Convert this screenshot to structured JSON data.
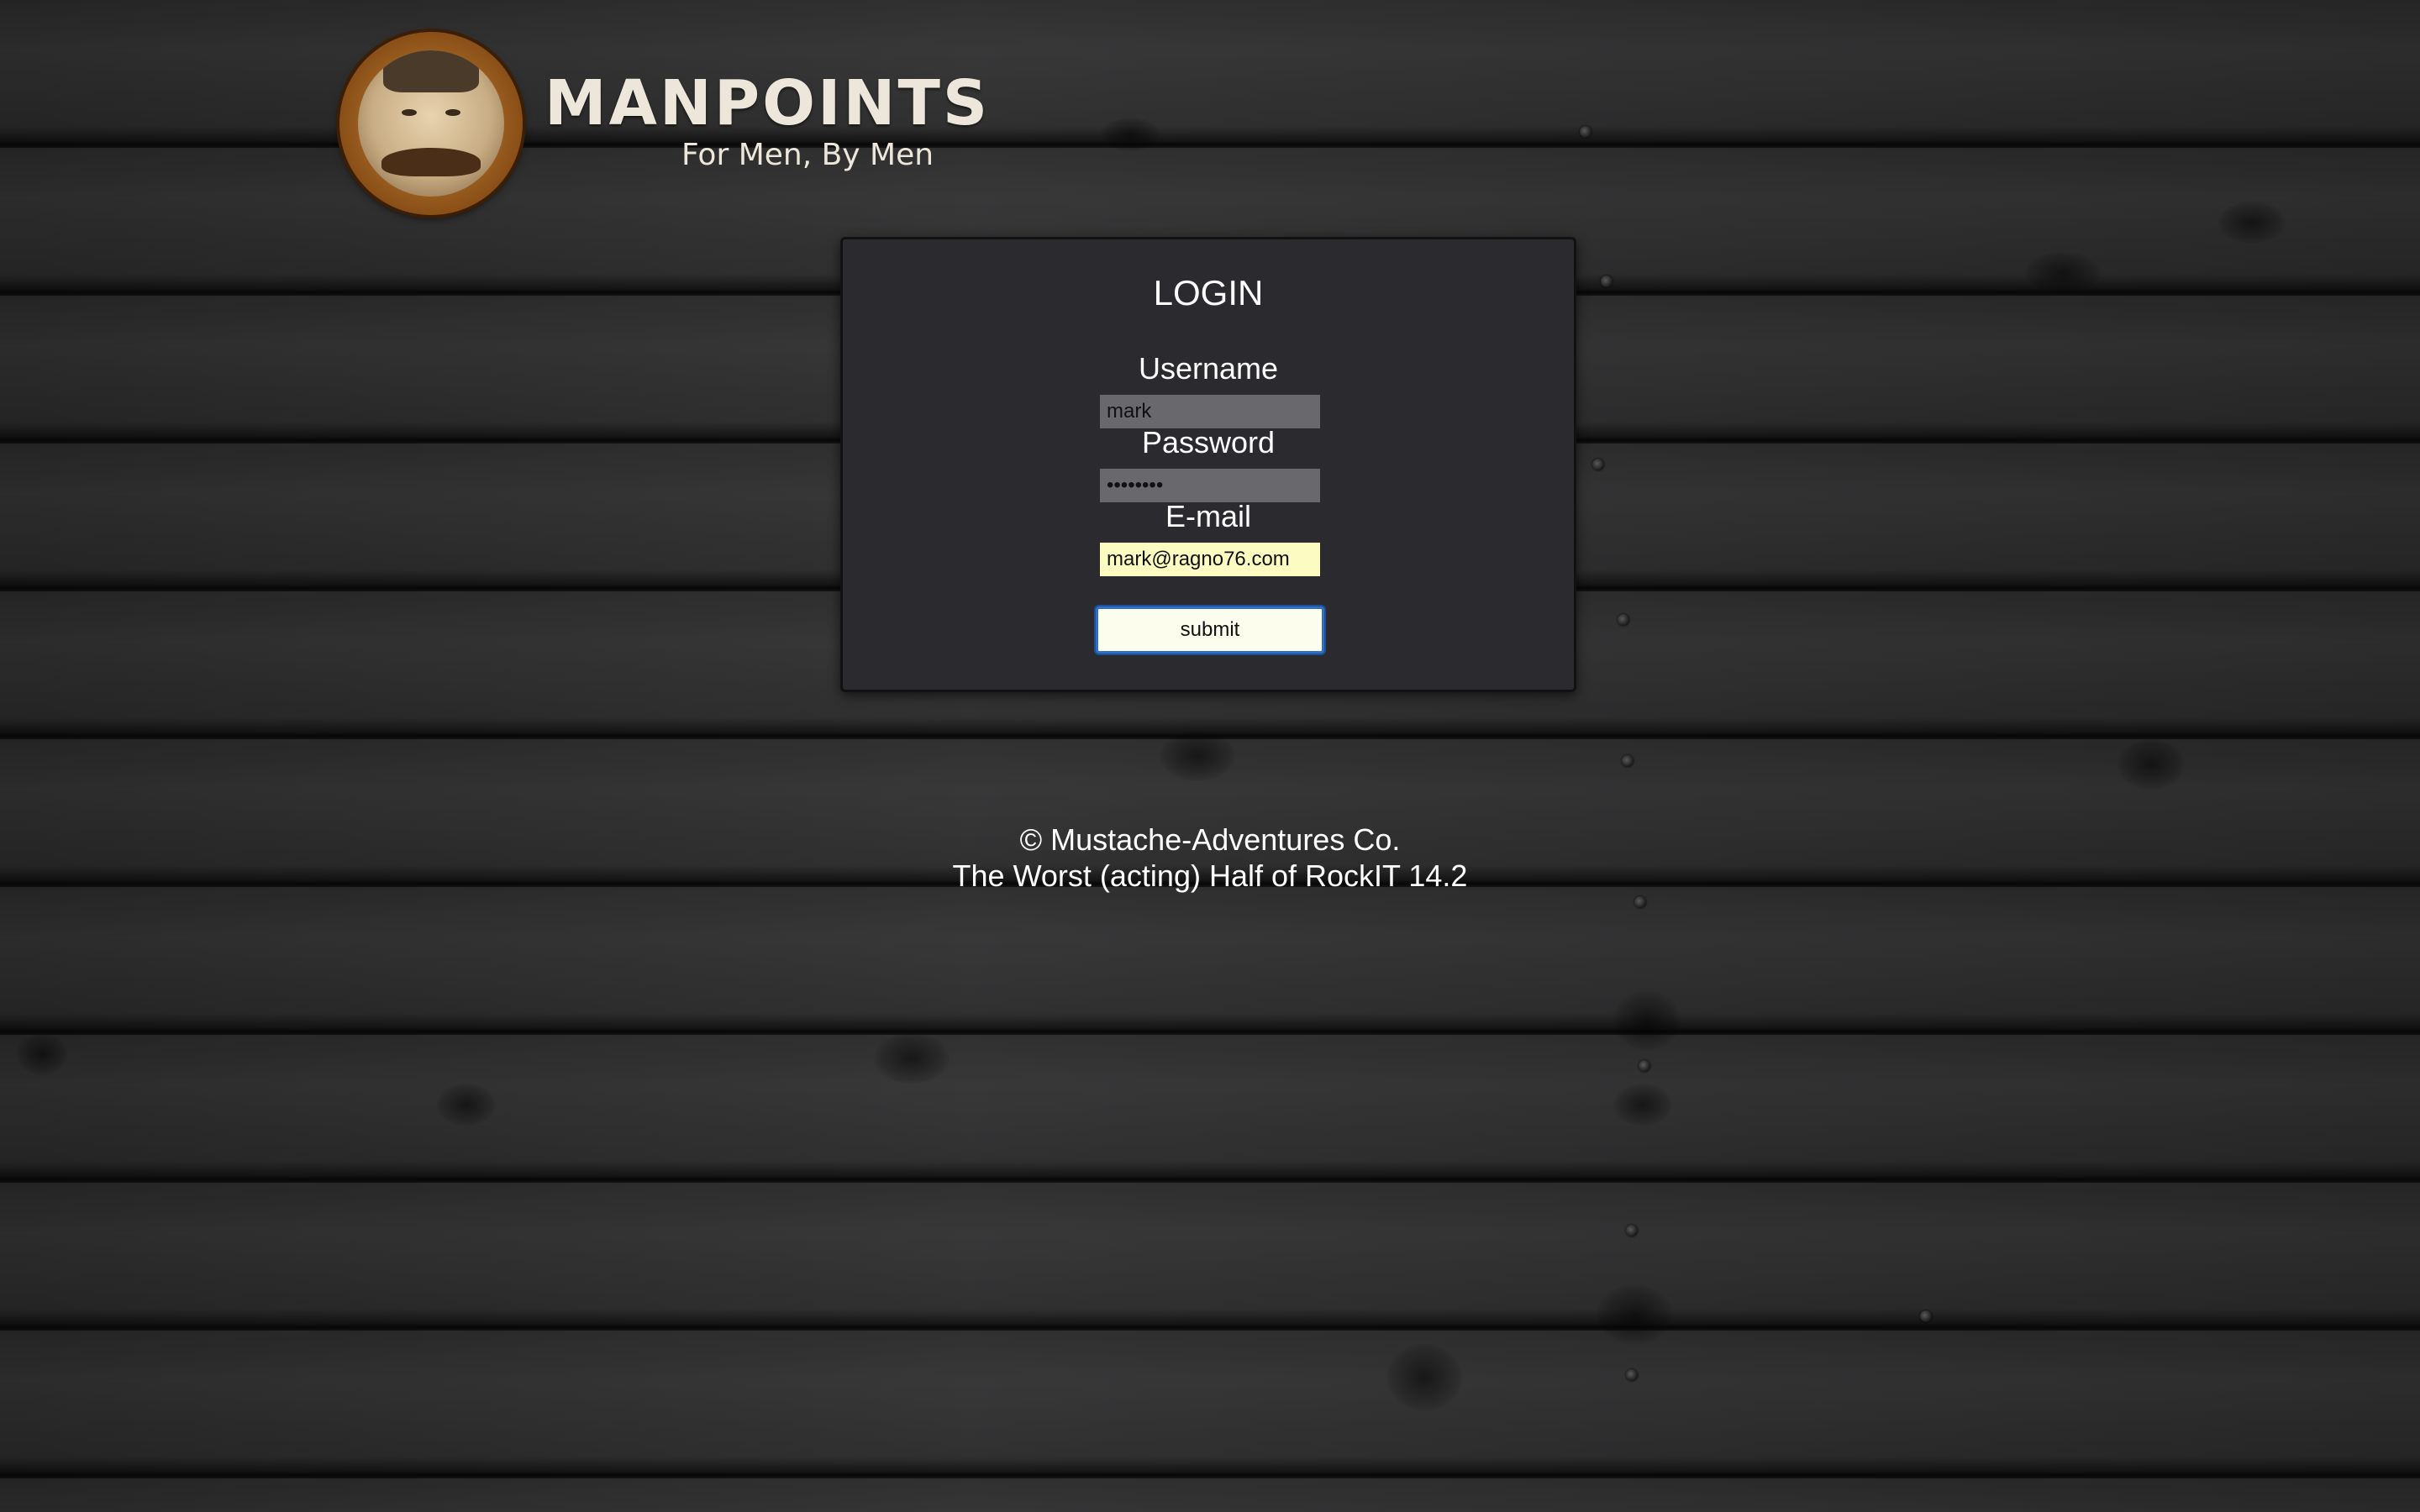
{
  "header": {
    "brand_title": "MANPOINTS",
    "tagline": "For Men, By Men"
  },
  "login": {
    "title": "LOGIN",
    "username_label": "Username",
    "username_value": "mark",
    "password_label": "Password",
    "password_value": "mark1234",
    "email_label": "E-mail",
    "email_value": "mark@ragno76.com",
    "submit_label": "submit"
  },
  "footer": {
    "copyright": "© Mustache-Adventures Co.",
    "credit": "The Worst (acting) Half of RockIT 14.2"
  },
  "colors": {
    "panel_bg": "#2b2b2f",
    "input_bg": "#69696d",
    "autofill_bg": "#fbfbc2",
    "button_focus": "#2f6fc6",
    "brand_text": "#ede6da"
  }
}
